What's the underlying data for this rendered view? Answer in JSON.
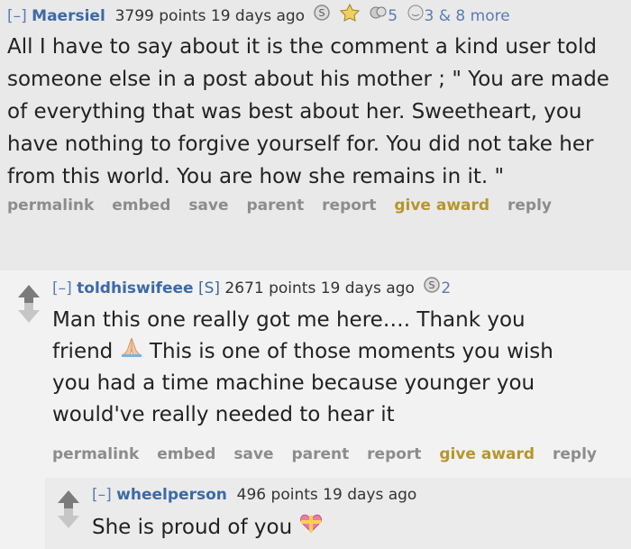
{
  "comment1": {
    "toggle": "[–]",
    "author": "Maersiel",
    "points": "3799 points",
    "time": "19 days ago",
    "award_count_1": "5",
    "award_count_2": "3 & 8 more",
    "body": "All I have to say about it is the comment a kind user told someone else in a post about his mother ; \" You are made of everything that was best about her. Sweetheart, you have nothing to forgive yourself for. You did not take her from this world. You are how she remains in it. \"",
    "buttons": [
      "permalink",
      "embed",
      "save",
      "parent",
      "report",
      "give award",
      "reply"
    ]
  },
  "comment2": {
    "toggle": "[–]",
    "author": "toldhiswifeee",
    "submitter_tag": "[S]",
    "points": "2671 points",
    "time": "19 days ago",
    "award_count": "2",
    "body_line1": "Man this one really got me here…. Thank you",
    "body_line2a": "friend",
    "body_line2b": "This is one of those moments you wish",
    "body_line3": "you had a time machine because younger you",
    "body_line4": "would've really needed to hear it",
    "buttons": [
      "permalink",
      "embed",
      "save",
      "parent",
      "report",
      "give award",
      "reply"
    ]
  },
  "comment3": {
    "toggle": "[–]",
    "author": "wheelperson",
    "points": "496 points",
    "time": "19 days ago",
    "body": "She is proud of you"
  },
  "colors": {
    "author": "#3d6aa6",
    "give_award": "#b6962c",
    "buttons": "#8c8c8c"
  }
}
